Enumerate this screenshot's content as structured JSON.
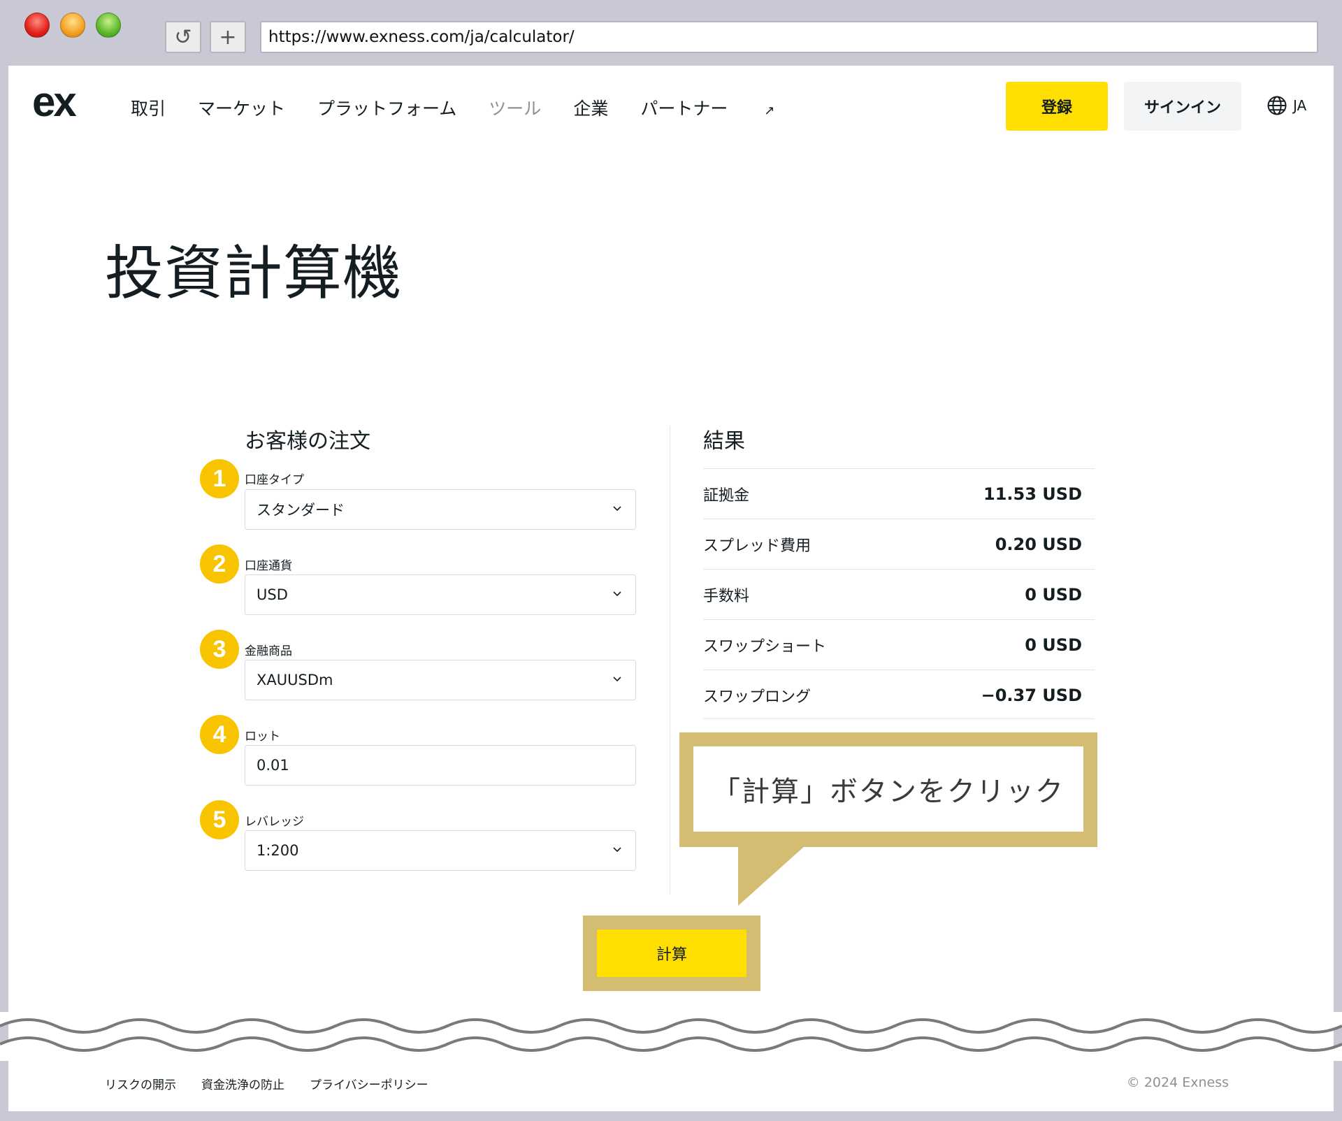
{
  "browser": {
    "url": "https://www.exness.com/ja/calculator/",
    "reload_glyph": "↺",
    "newtab_glyph": "+"
  },
  "header": {
    "logo": "ex",
    "nav": [
      {
        "label": "取引",
        "active": false
      },
      {
        "label": "マーケット",
        "active": false
      },
      {
        "label": "プラットフォーム",
        "active": false
      },
      {
        "label": "ツール",
        "active": true
      },
      {
        "label": "企業",
        "active": false
      },
      {
        "label": "パートナー",
        "active": false,
        "external_glyph": "↗"
      }
    ],
    "register_label": "登録",
    "signin_label": "サインイン",
    "language": "JA"
  },
  "page_title": "投資計算機",
  "order": {
    "title": "お客様の注文",
    "fields": [
      {
        "step": "1",
        "label": "口座タイプ",
        "value": "スタンダード",
        "type": "select"
      },
      {
        "step": "2",
        "label": "口座通貨",
        "value": "USD",
        "type": "select"
      },
      {
        "step": "3",
        "label": "金融商品",
        "value": "XAUUSDm",
        "type": "select"
      },
      {
        "step": "4",
        "label": "ロット",
        "value": "0.01",
        "type": "input"
      },
      {
        "step": "5",
        "label": "レバレッジ",
        "value": "1:200",
        "type": "select"
      }
    ]
  },
  "results": {
    "title": "結果",
    "rows": [
      {
        "label": "証拠金",
        "value": "11.53 USD"
      },
      {
        "label": "スプレッド費用",
        "value": "0.20 USD"
      },
      {
        "label": "手数料",
        "value": "0 USD"
      },
      {
        "label": "スワップショート",
        "value": "0 USD"
      },
      {
        "label": "スワップロング",
        "value": "−0.37 USD"
      }
    ]
  },
  "callout": {
    "text": "「計算」ボタンをクリック"
  },
  "calculate_label": "計算",
  "footer": {
    "links": [
      "リスクの開示",
      "資金洗浄の防止",
      "プライバシーポリシー"
    ],
    "copyright": "© 2024 Exness"
  },
  "colors": {
    "accent": "#ffde02",
    "badge": "#f8c400",
    "callout_frame": "#d4bc72"
  }
}
